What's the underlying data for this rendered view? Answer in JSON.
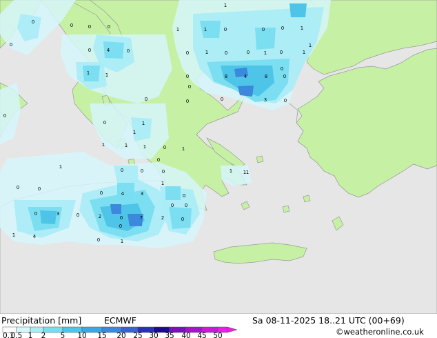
{
  "title": {
    "label": "Precipitation [mm]",
    "model": "ECMWF",
    "valid_time": "Sa 08-11-2025 18..21 UTC (00+69)",
    "credit": "©weatheronline.co.uk"
  },
  "legend": {
    "ticks": [
      "0.1",
      "0.5",
      "1",
      "2",
      "5",
      "10",
      "15",
      "20",
      "25",
      "30",
      "35",
      "40",
      "45",
      "50"
    ],
    "colors": [
      "#ffffff",
      "#d6f6fb",
      "#a9ecf6",
      "#79ddf0",
      "#4ec5e8",
      "#3ca7e4",
      "#3b88dc",
      "#3a62d0",
      "#2a2fb8",
      "#1a0a8c",
      "#7a10b8",
      "#a414c8",
      "#cc18d8",
      "#ec1ee4"
    ]
  },
  "colors": {
    "sea": "#e6e6e6",
    "land": "#c6f0a4",
    "coast": "#9a9a9a",
    "precip_light": "#d6f6fb",
    "precip_mid": "#a9ecf6",
    "precip_heavy": "#79ddf0",
    "precip_core": "#4ec5e8",
    "precip_max": "#3b88dc"
  },
  "map_labels": [
    "0",
    "0",
    "0",
    "0",
    "0",
    "0",
    "1",
    "1",
    "0",
    "0",
    "1",
    "1",
    "0",
    "0",
    "0",
    "0",
    "0",
    "4",
    "0",
    "1",
    "1",
    "1",
    "0",
    "0",
    "0",
    "1",
    "1",
    "0",
    "1",
    "0",
    "4",
    "0",
    "8",
    "4",
    "8",
    "0",
    "3",
    "0",
    "0",
    "0",
    "0",
    "0",
    "0",
    "1",
    "1",
    "1",
    "0",
    "0",
    "1",
    "1",
    "1",
    "0",
    "0",
    "1",
    "0",
    "0",
    "1",
    "4",
    "2",
    "0",
    "3",
    "2",
    "0",
    "0",
    "3",
    "7",
    "0",
    "0",
    "1",
    "1",
    "0",
    "1",
    "1",
    "0",
    "0",
    "1"
  ]
}
